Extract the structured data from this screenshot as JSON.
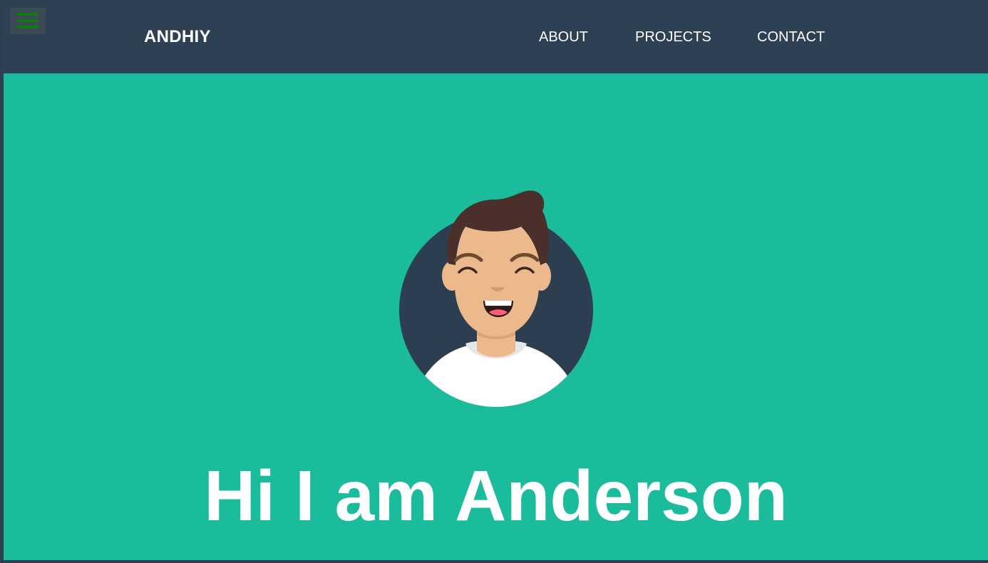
{
  "navbar": {
    "brand": "ANDHIY",
    "links": [
      {
        "label": "ABOUT"
      },
      {
        "label": "PROJECTS"
      },
      {
        "label": "CONTACT"
      }
    ]
  },
  "hero": {
    "title": "Hi I am Anderson"
  },
  "colors": {
    "navbar_bg": "#2e4053",
    "hero_bg": "#1abc9c",
    "menu_icon": "#0f7a0f",
    "avatar_circle": "#2c3e50"
  }
}
